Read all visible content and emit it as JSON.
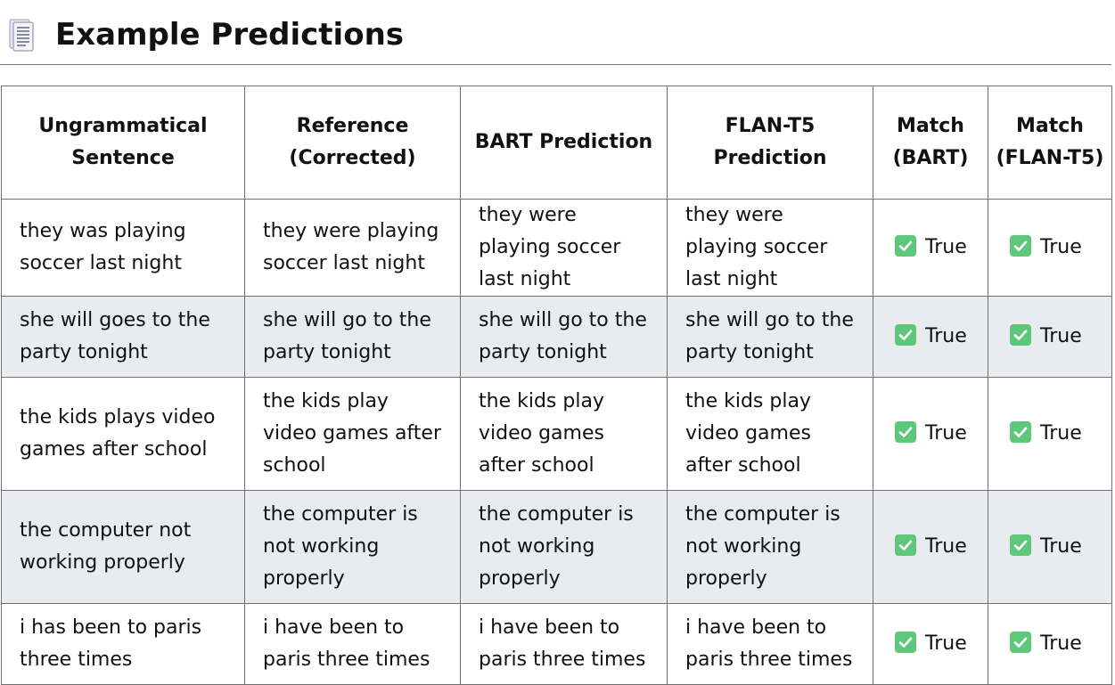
{
  "header": {
    "icon": "scroll-icon",
    "title": "Example Predictions"
  },
  "table": {
    "columns": [
      "Ungrammatical Sentence",
      "Reference (Corrected)",
      "BART Prediction",
      "FLAN-T5 Prediction",
      "Match (BART)",
      "Match (FLAN-T5)"
    ],
    "rows": [
      {
        "ungrammatical": "they was playing soccer last night",
        "reference": "they were playing soccer last night",
        "bart": "they were playing soccer last night",
        "flan": "they were playing soccer last night",
        "match_bart": "True",
        "match_flan": "True"
      },
      {
        "ungrammatical": "she will goes to the party tonight",
        "reference": "she will go to the party tonight",
        "bart": "she will go to the party tonight",
        "flan": "she will go to the party tonight",
        "match_bart": "True",
        "match_flan": "True"
      },
      {
        "ungrammatical": "the kids plays video games after school",
        "reference": "the kids play video games after school",
        "bart": "the kids play video games after school",
        "flan": "the kids play video games after school",
        "match_bart": "True",
        "match_flan": "True"
      },
      {
        "ungrammatical": "the computer not working properly",
        "reference": "the computer is not working properly",
        "bart": "the computer is not working properly",
        "flan": "the computer is not working properly",
        "match_bart": "True",
        "match_flan": "True"
      },
      {
        "ungrammatical": "i has been to paris three times",
        "reference": "i have been to paris three times",
        "bart": "i have been to paris three times",
        "flan": "i have been to paris three times",
        "match_bart": "True",
        "match_flan": "True"
      }
    ]
  },
  "colors": {
    "check_icon": "#5fc77a",
    "row_alt": "#e8ebef",
    "border": "#6f6f6f"
  }
}
